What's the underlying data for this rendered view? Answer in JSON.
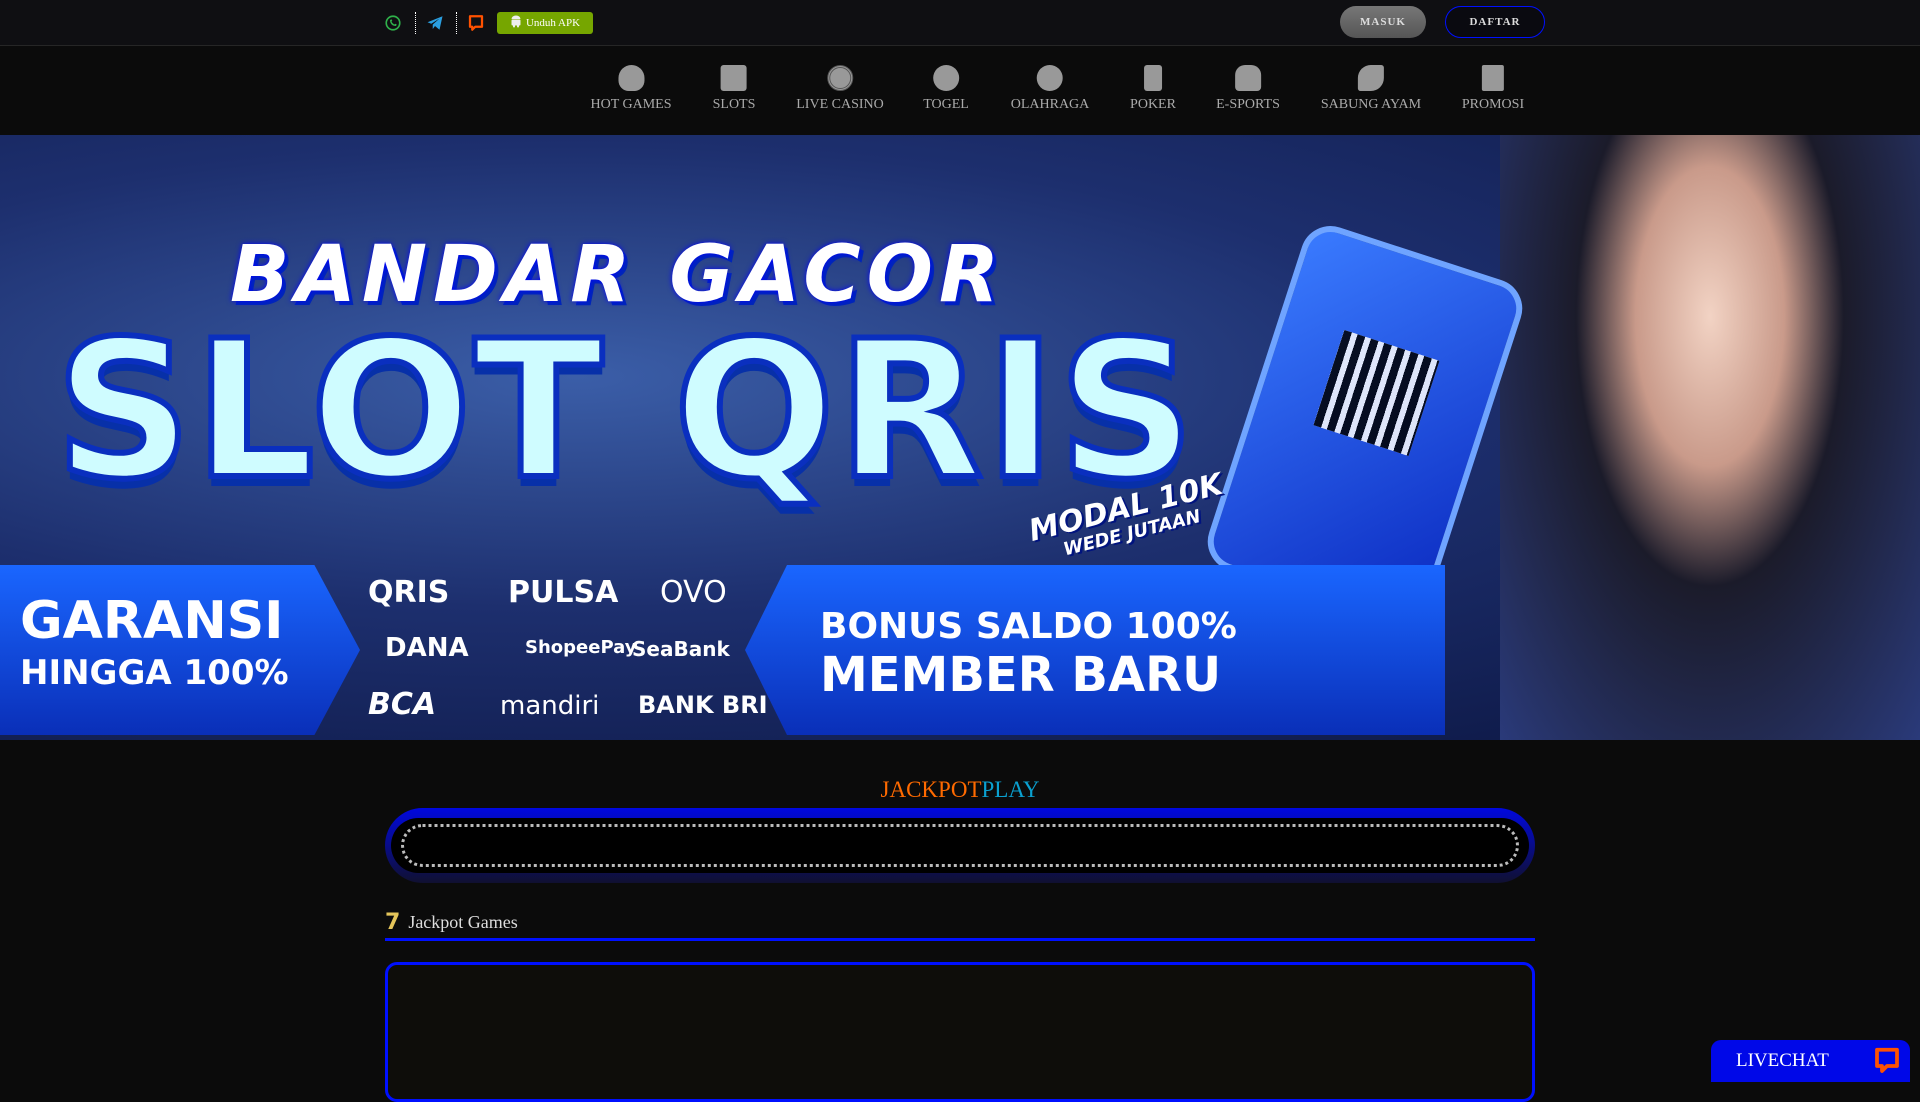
{
  "topbar": {
    "icons": [
      "whatsapp-icon",
      "telegram-icon",
      "livechat-icon"
    ],
    "apk_label": "Unduh APK",
    "login_label": "MASUK",
    "register_label": "DAFTAR"
  },
  "nav": {
    "items": [
      {
        "label": "HOT GAMES"
      },
      {
        "label": "SLOTS"
      },
      {
        "label": "LIVE CASINO"
      },
      {
        "label": "TOGEL"
      },
      {
        "label": "OLAHRAGA"
      },
      {
        "label": "POKER"
      },
      {
        "label": "E-SPORTS"
      },
      {
        "label": "SABUNG AYAM"
      },
      {
        "label": "PROMOSI"
      }
    ]
  },
  "banner": {
    "headline": "BANDAR GACOR",
    "title": "SLOT QRIS",
    "modal_line1": "MODAL 10K",
    "modal_line2": "WEDE JUTAAN",
    "guarantee_line1": "GARANSI",
    "guarantee_line2": "HINGGA 100%",
    "bonus_line1": "BONUS SALDO 100%",
    "bonus_line2": "MEMBER BARU",
    "payments": [
      "QRIS",
      "PULSA",
      "OVO",
      "DANA",
      "ShopeePay",
      "SeaBank",
      "BCA",
      "mandiri",
      "BANK BRI"
    ]
  },
  "jackpot": {
    "title_part1": "JACKPOT",
    "title_part2": "PLAY",
    "color1": "#ff6a00",
    "color2": "#0aa0d0"
  },
  "jackpot_games": {
    "icon": "seven-icon",
    "label": "Jackpot Games"
  },
  "livechat": {
    "label": "LIVECHAT"
  },
  "colors": {
    "accent": "#0010ff",
    "apk": "#76a600",
    "chat": "#ff5100"
  }
}
